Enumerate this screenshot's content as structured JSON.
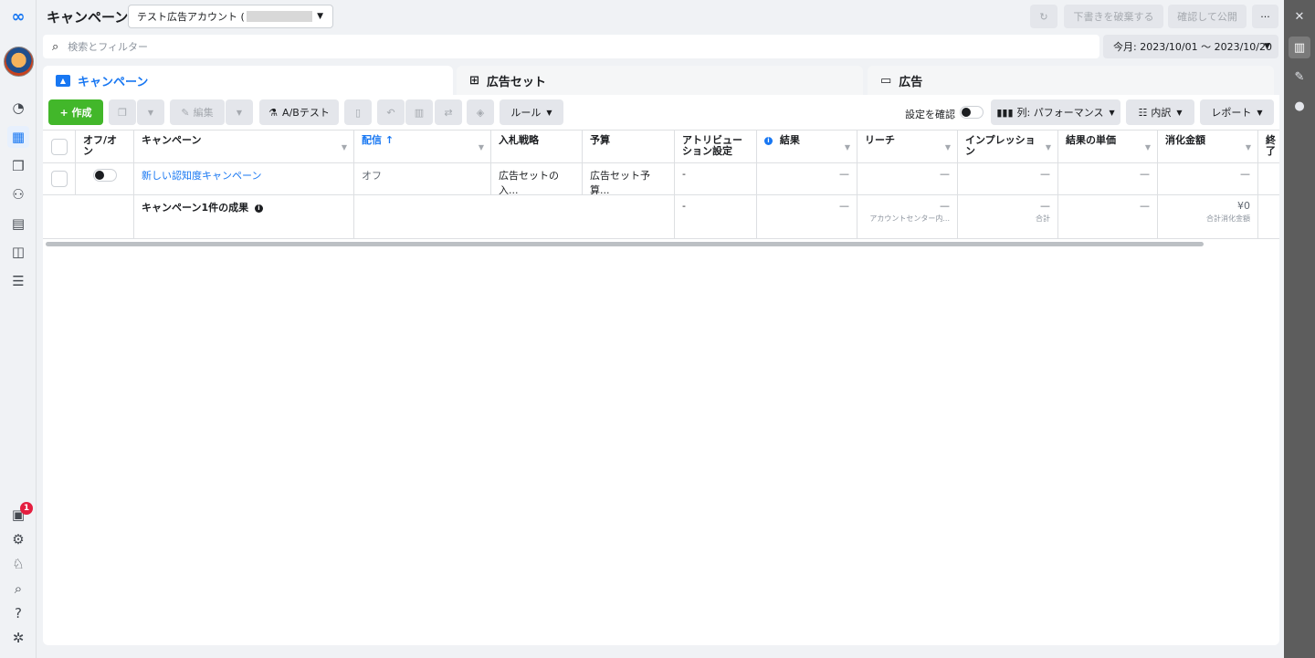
{
  "header": {
    "title": "キャンペーン",
    "account_label": "テスト広告アカウント (",
    "discard_label": "下書きを破棄する",
    "publish_label": "確認して公開",
    "more_label": "···",
    "refresh_icon": "refresh-icon"
  },
  "search": {
    "placeholder": "検索とフィルター"
  },
  "date_range": "今月: 2023/10/01 〜 2023/10/20",
  "tabs": [
    {
      "label": "キャンペーン",
      "icon": "folder-icon"
    },
    {
      "label": "広告セット",
      "icon": "grid-icon"
    },
    {
      "label": "広告",
      "icon": "ad-icon"
    }
  ],
  "toolbar": {
    "create": "+ 作成",
    "edit": "編集",
    "ab_test": "A/Bテスト",
    "rules": "ルール",
    "confirm_settings": "設定を確認",
    "columns": "列: パフォーマンス",
    "breakdown": "内訳",
    "report": "レポート"
  },
  "table": {
    "headers": {
      "onoff": "オフ/オン",
      "campaign": "キャンペーン",
      "delivery": "配信 ↑",
      "bid": "入札戦略",
      "budget": "予算",
      "attribution": "アトリビューション設定",
      "results": "結果",
      "reach": "リーチ",
      "impressions": "インプレッション",
      "cost_per_result": "結果の単価",
      "amount_spent": "消化金額",
      "ends": "終了"
    },
    "row": {
      "name": "新しい認知度キャンペーン",
      "delivery": "オフ",
      "bid": "広告セットの入...",
      "budget": "広告セット予算...",
      "attribution": "-",
      "results": "—",
      "reach": "—",
      "impressions": "—",
      "cost_per_result": "—",
      "amount_spent": "—"
    },
    "summary": {
      "label": "キャンペーン1件の成果",
      "attribution": "-",
      "results": "—",
      "reach": "—",
      "reach_sub": "アカウントセンター内...",
      "impressions": "—",
      "impressions_sub": "合計",
      "cost_per_result": "—",
      "amount_spent": "¥0",
      "amount_spent_sub": "合計消化金額"
    }
  },
  "notifications_count": "1"
}
